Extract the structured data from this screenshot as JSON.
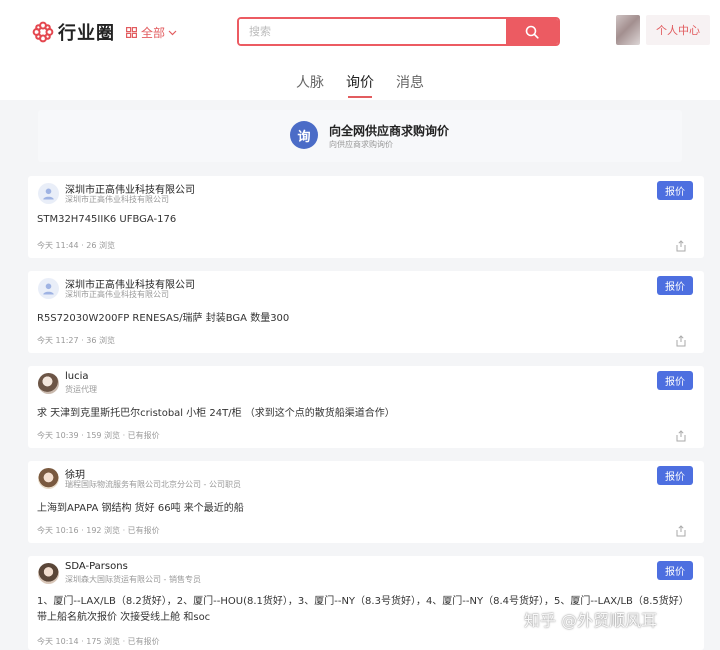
{
  "header": {
    "logo_text": "行业圈",
    "category": "全部",
    "search_placeholder": "搜索",
    "user_center": "个人中心"
  },
  "tabs": [
    {
      "label": "人脉",
      "active": false
    },
    {
      "label": "询价",
      "active": true
    },
    {
      "label": "消息",
      "active": false
    }
  ],
  "banner": {
    "icon_char": "询",
    "title": "向全网供应商求购询价",
    "subtitle": "向供应商求购询价"
  },
  "quote_label": "报价",
  "posts": [
    {
      "name": "深圳市正高伟业科技有限公司",
      "subtitle": "深圳市正高伟业科技有限公司",
      "content": "STM32H745IIK6 UFBGA-176",
      "meta": "今天 11:44 · 26 浏览"
    },
    {
      "name": "深圳市正高伟业科技有限公司",
      "subtitle": "深圳市正高伟业科技有限公司",
      "content": "R5S72030W200FP RENESAS/瑞萨 封装BGA 数量300",
      "meta": "今天 11:27 · 36 浏览"
    },
    {
      "name": "lucia",
      "subtitle": "货运代理",
      "content": "求 天津到克里斯托巴尔cristobal 小柜 24T/柜 （求到这个点的散货船渠道合作）",
      "meta": "今天 10:39 · 159 浏览 · 已有报价"
    },
    {
      "name": "徐玥",
      "subtitle": "瑞程国际物流服务有限公司北京分公司 - 公司职员",
      "content": "上海到APAPA 钢结构 货好 66吨 来个最近的船",
      "meta": "今天 10:16 · 192 浏览 · 已有报价"
    },
    {
      "name": "SDA-Parsons",
      "subtitle": "深圳森大国际货运有限公司 - 销售专员",
      "content": "1、厦门--LAX/LB（8.2货好），2、厦门--HOU(8.1货好），3、厦门--NY（8.3号货好），4、厦门--NY（8.4号货好），5、厦门--LAX/LB（8.5货好）带上船名航次报价 次接受线上舱 和soc",
      "meta": "今天 10:14 · 175 浏览 · 已有报价"
    }
  ],
  "watermark": "知乎 @外贸顺风耳",
  "colors": {
    "brand_red": "#ec5b62",
    "quote_blue": "#4d6fe0",
    "banner_icon": "#4b6cc7"
  }
}
